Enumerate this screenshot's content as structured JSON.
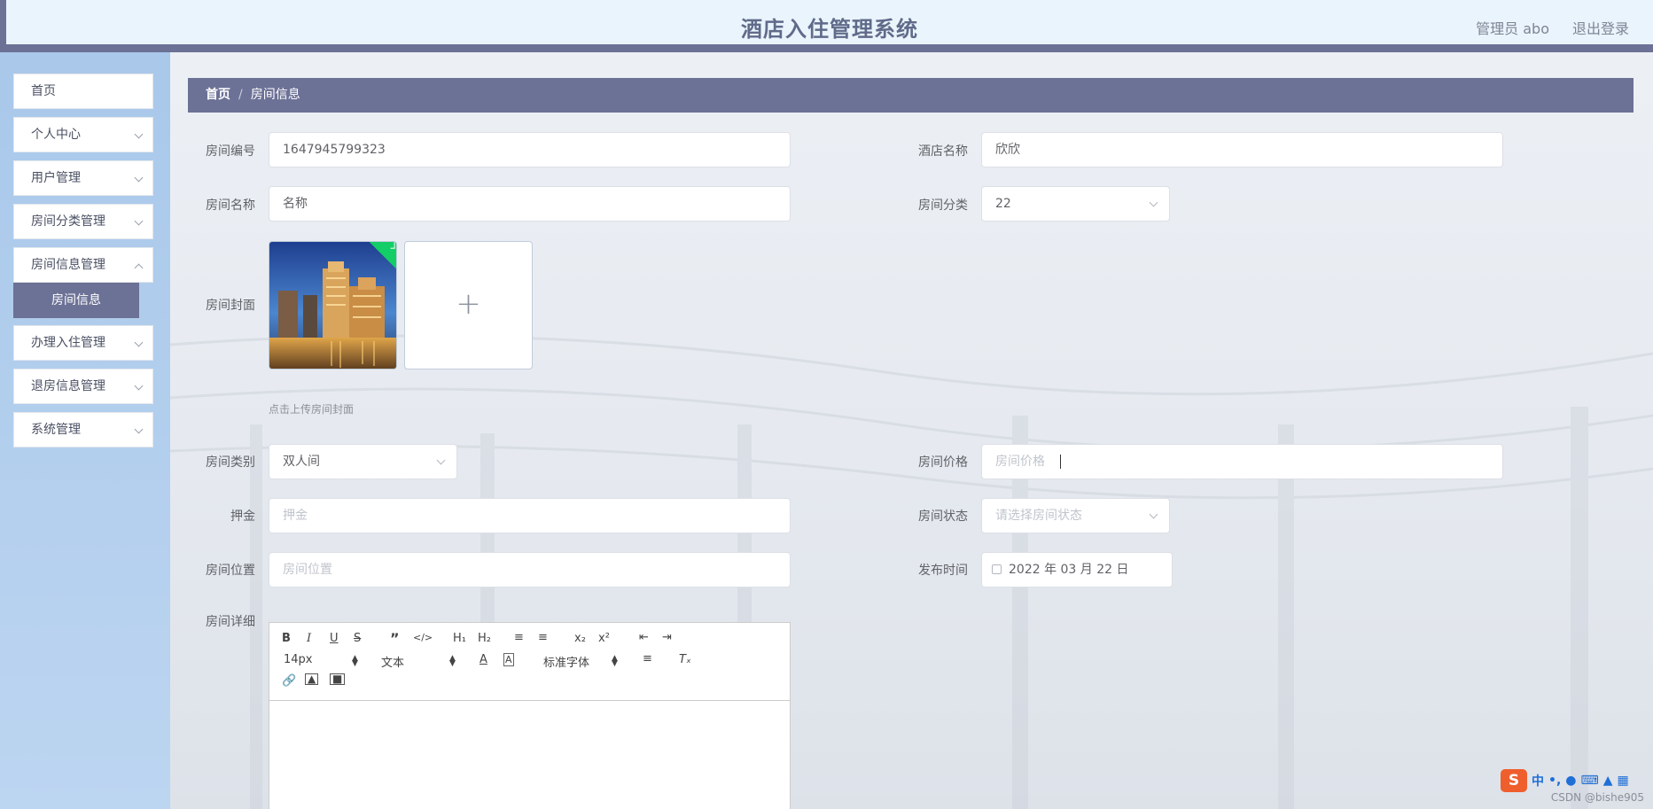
{
  "header": {
    "title": "酒店入住管理系统",
    "user": "管理员 abo",
    "logout": "退出登录"
  },
  "sidebar": {
    "items": [
      {
        "label": "首页",
        "has_arrow": false
      },
      {
        "label": "个人中心",
        "has_arrow": true
      },
      {
        "label": "用户管理",
        "has_arrow": true
      },
      {
        "label": "房间分类管理",
        "has_arrow": true
      },
      {
        "label": "房间信息管理",
        "has_arrow": true
      },
      {
        "label": "房间信息",
        "active_sub": true
      },
      {
        "label": "办理入住管理",
        "has_arrow": true
      },
      {
        "label": "退房信息管理",
        "has_arrow": true
      },
      {
        "label": "系统管理",
        "has_arrow": true
      }
    ]
  },
  "breadcrumb": {
    "home": "首页",
    "separator": "/",
    "current": "房间信息"
  },
  "form": {
    "room_no": {
      "label": "房间编号",
      "value": "1647945799323"
    },
    "hotel_name": {
      "label": "酒店名称",
      "value": "欣欣"
    },
    "room_name": {
      "label": "房间名称",
      "value": "名称"
    },
    "room_category": {
      "label": "房间分类",
      "value": "22"
    },
    "room_cover": {
      "label": "房间封面",
      "tip": "点击上传房间封面",
      "add_symbol": "+"
    },
    "room_type": {
      "label": "房间类别",
      "value": "双人间"
    },
    "room_price": {
      "label": "房间价格",
      "placeholder": "房间价格"
    },
    "deposit": {
      "label": "押金",
      "placeholder": "押金"
    },
    "room_status": {
      "label": "房间状态",
      "placeholder": "请选择房间状态"
    },
    "room_location": {
      "label": "房间位置",
      "placeholder": "房间位置"
    },
    "publish_time": {
      "label": "发布时间",
      "value": "2022 年 03 月 22 日"
    },
    "room_detail": {
      "label": "房间详细"
    }
  },
  "editor": {
    "font_size": "14px",
    "block_format": "文本",
    "font_family": "标准字体"
  },
  "ime": {
    "lang": "中"
  },
  "watermark": "CSDN @bishe905",
  "colors": {
    "accent": "#6c7196",
    "success": "#13ce66",
    "header_bg": "#eaf4fc"
  }
}
